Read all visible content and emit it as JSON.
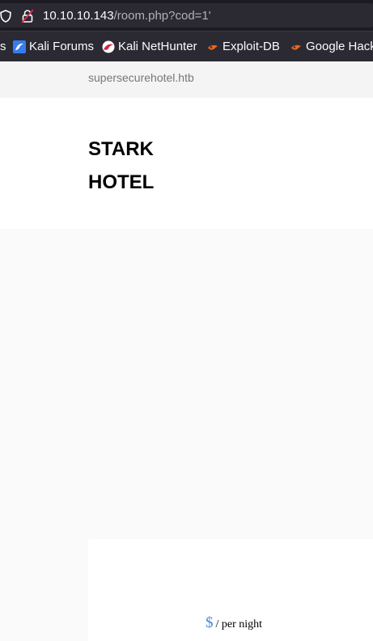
{
  "browser": {
    "url_host": "10.10.10.143",
    "url_path": "/room.php?cod=1'",
    "bookmarks": [
      {
        "label": "s",
        "icon": "bookmark-icon"
      },
      {
        "label": "Kali Forums",
        "icon": "kali-forums-icon"
      },
      {
        "label": "Kali NetHunter",
        "icon": "kali-nethunter-icon"
      },
      {
        "label": "Exploit-DB",
        "icon": "exploit-db-icon"
      },
      {
        "label": "Google Hack",
        "icon": "exploit-db-icon"
      }
    ]
  },
  "page": {
    "site_domain": "supersecurehotel.htb",
    "brand_line1": "STARK",
    "brand_line2": "HOTEL",
    "price_currency": "$",
    "price_unit": "/ per night"
  },
  "colors": {
    "url_bar": "#1c1b22",
    "bookmark_bar": "#2b2a33",
    "price_accent": "#4a89dc"
  }
}
